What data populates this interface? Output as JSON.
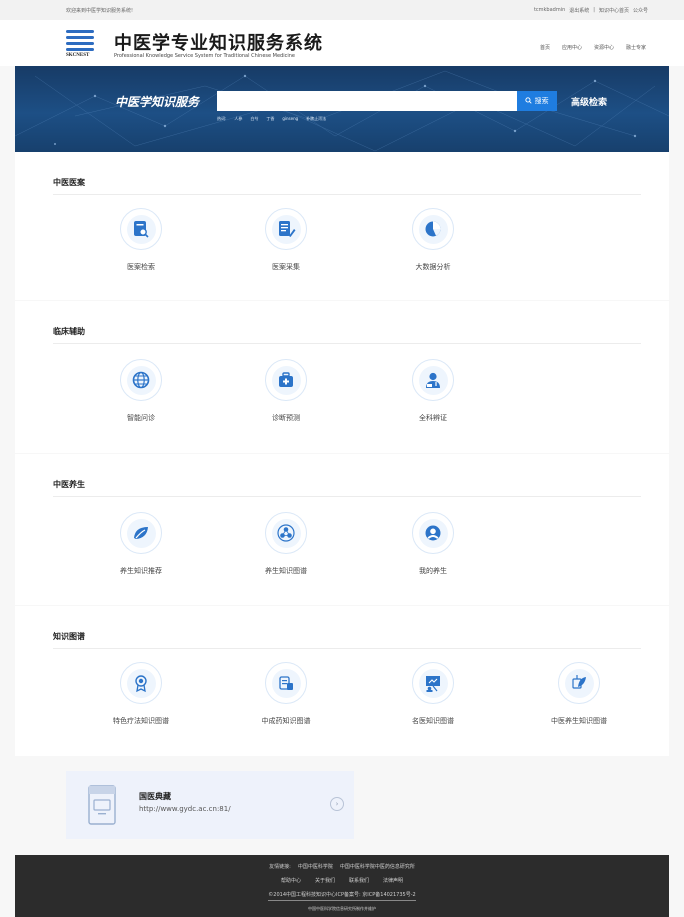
{
  "topbar": {
    "welcome": "欢迎来到中医学知识服务系统!",
    "user": "tcmkbadmin",
    "logout": "退出系统",
    "separator": "|",
    "kc_home": "知识中心首页",
    "official": "公众号"
  },
  "header": {
    "logo_abbr": "SKCNEST",
    "title": "中医学专业知识服务系统",
    "subtitle": "Professional Knowledge Service System for Traditional Chinese Medicine",
    "nav": [
      "首页",
      "应用中心",
      "资源中心",
      "融士专家"
    ]
  },
  "banner": {
    "brand": "中医学知识服务",
    "search_placeholder": "",
    "search_button": "搜索",
    "advanced": "高级检索",
    "hot_label": "热词:",
    "hot_words": [
      "人参",
      "白芍",
      "丁香",
      "ginseng",
      "补脾止泻法"
    ]
  },
  "sections": [
    {
      "title": "中医医案",
      "items": [
        {
          "label": "医案检索",
          "icon": "case-search-icon"
        },
        {
          "label": "医案采集",
          "icon": "case-collect-icon"
        },
        {
          "label": "大数据分析",
          "icon": "pie-chart-icon"
        }
      ]
    },
    {
      "title": "临床辅助",
      "items": [
        {
          "label": "智能问诊",
          "icon": "globe-icon"
        },
        {
          "label": "诊断预测",
          "icon": "medical-kit-icon"
        },
        {
          "label": "全科辨证",
          "icon": "doctor-icon"
        }
      ]
    },
    {
      "title": "中医养生",
      "items": [
        {
          "label": "养生知识推荐",
          "icon": "leaf-icon"
        },
        {
          "label": "养生知识图谱",
          "icon": "graph-node-icon"
        },
        {
          "label": "我的养生",
          "icon": "user-icon"
        }
      ]
    },
    {
      "title": "知识图谱",
      "items": [
        {
          "label": "特色疗法知识图谱",
          "icon": "award-icon"
        },
        {
          "label": "中成药知识图谱",
          "icon": "medicine-icon"
        },
        {
          "label": "名医知识图谱",
          "icon": "teacher-icon"
        },
        {
          "label": "中医养生知识图谱",
          "icon": "herb-icon"
        }
      ]
    }
  ],
  "resource": {
    "name": "国医典藏",
    "url": "http://www.gydc.ac.cn:81/",
    "arrow": "›"
  },
  "footer": {
    "friend_label": "友情链接:",
    "friend_links": [
      "中国中医科学院",
      "中国中医科学院中医药信息研究所"
    ],
    "links": [
      "帮助中心",
      "关于我们",
      "联系我们",
      "法律声明"
    ],
    "copyright": "©2014中国工程科技知识中心ICP备案号: 京ICP备14021735号-2",
    "maintainer": "中国中医科学院信息研究所制作并维护"
  },
  "colors": {
    "banner": "#1d4f85",
    "accent": "#1f7de0",
    "icon": "#2c74c9",
    "footer": "#2c2c2c"
  }
}
